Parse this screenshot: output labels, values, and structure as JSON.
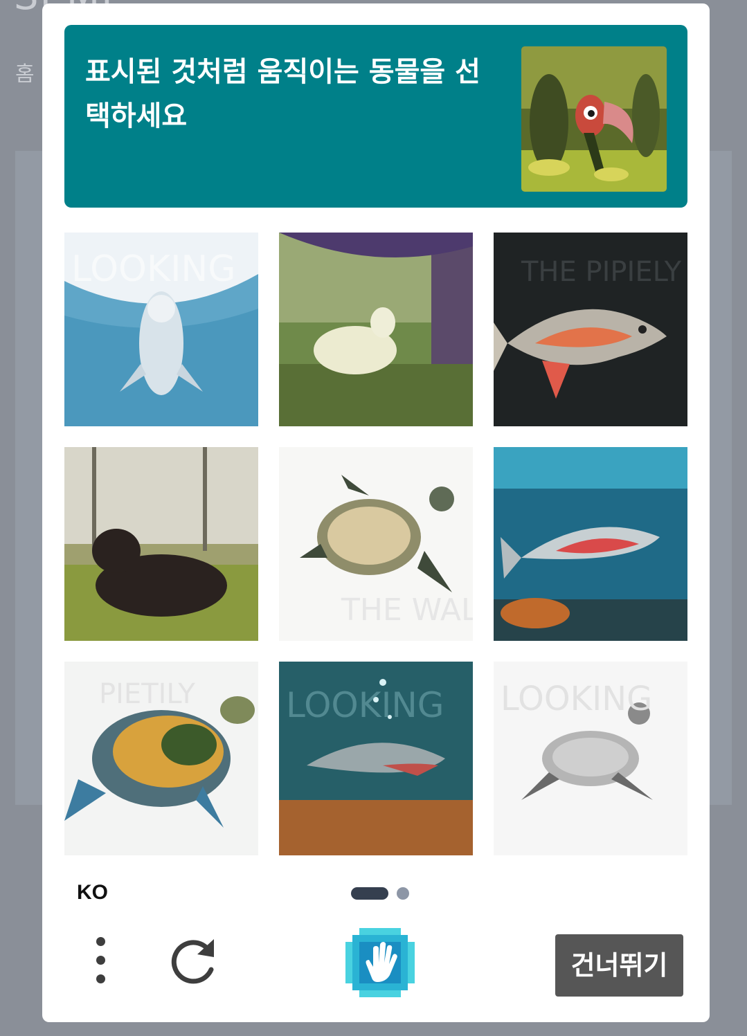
{
  "background": {
    "title": "SI  MI",
    "breadcrumb_home": "홈"
  },
  "challenge": {
    "prompt": "표시된 것처럼 움직이는 동물을 선택하세요",
    "tiles": [
      {
        "subject": "dolphin",
        "watermark": "LOOKING"
      },
      {
        "subject": "sheep",
        "watermark": ""
      },
      {
        "subject": "fish",
        "watermark": "THE PIPIELY"
      },
      {
        "subject": "sheep",
        "watermark": ""
      },
      {
        "subject": "turtle",
        "watermark": "THE WALKING STORIES"
      },
      {
        "subject": "fish",
        "watermark": ""
      },
      {
        "subject": "turtle",
        "watermark": "PIETILY"
      },
      {
        "subject": "fish",
        "watermark": "LOOKING"
      },
      {
        "subject": "turtle",
        "watermark": "LOOKING"
      }
    ]
  },
  "footer": {
    "language": "KO",
    "skip_label": "건너뛰기",
    "page_current": 1,
    "page_total": 2
  },
  "icons": {
    "menu": "vertical-dots-icon",
    "refresh": "refresh-icon",
    "logo": "hcaptcha-hand-logo"
  },
  "colors": {
    "prompt_bg": "#008089",
    "skip_bg": "#565656",
    "pager_active": "#353f4f",
    "pager_inactive": "#8d96a6"
  }
}
